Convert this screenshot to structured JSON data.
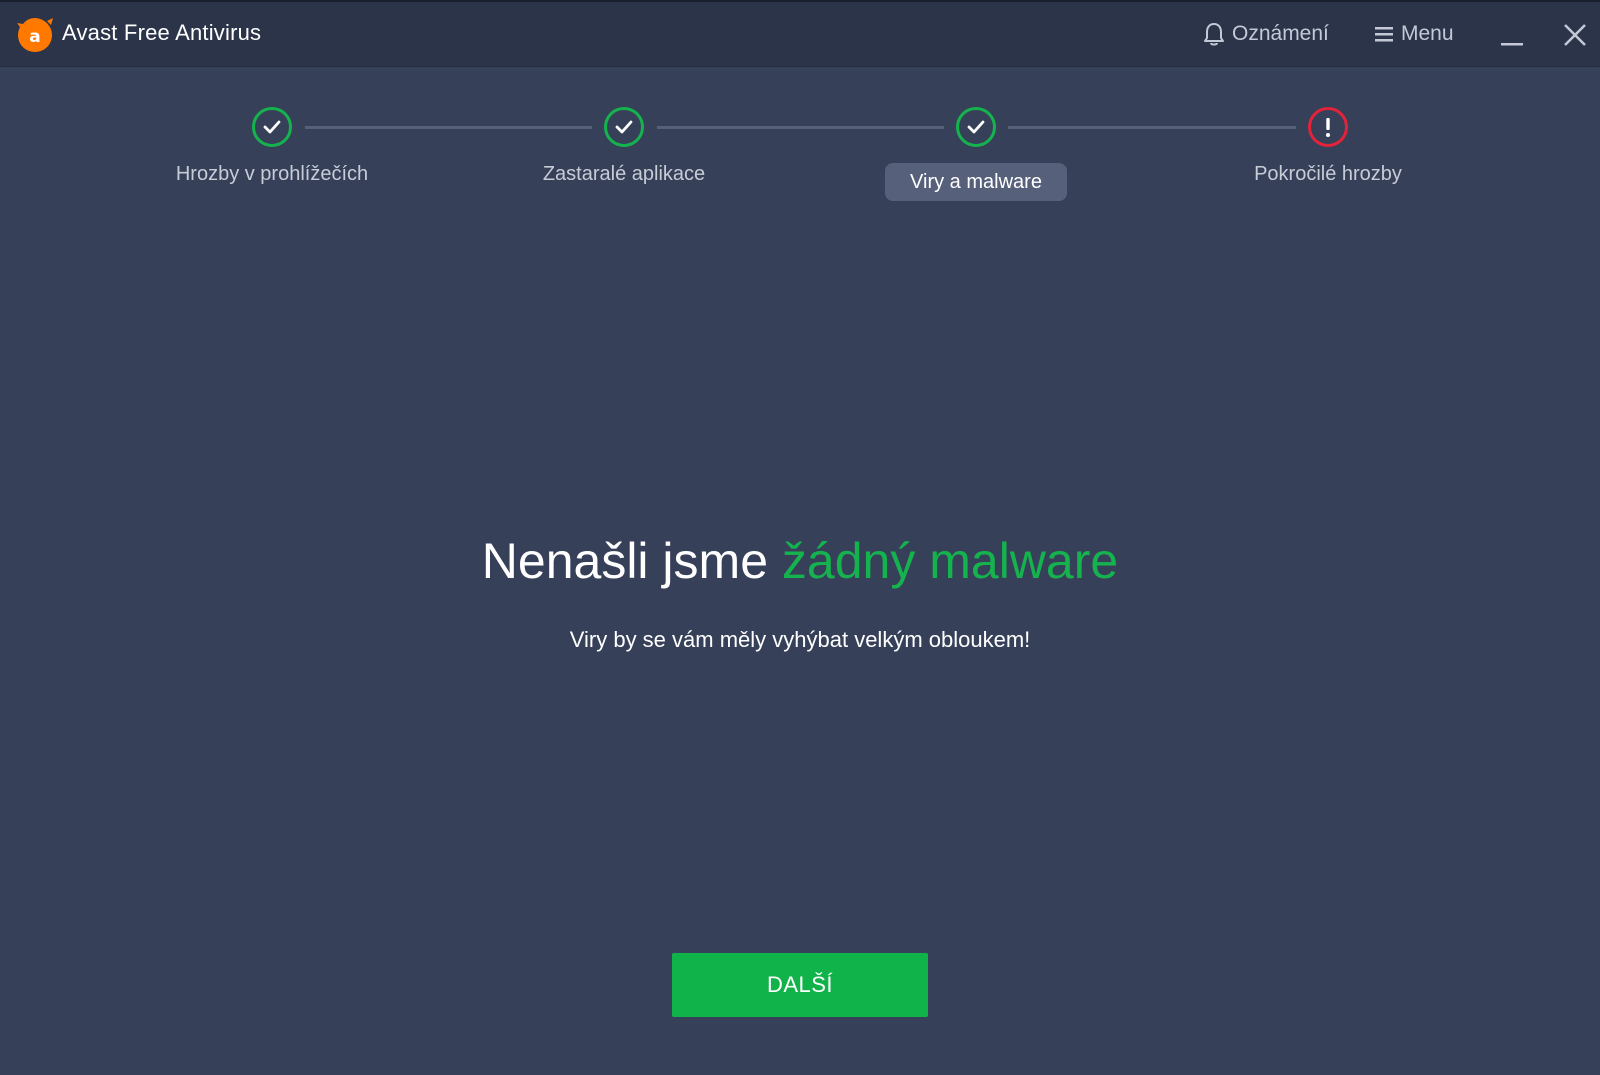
{
  "titlebar": {
    "app_title": "Avast Free Antivirus",
    "notifications_label": "Oznámení",
    "menu_label": "Menu"
  },
  "stepper": {
    "steps": [
      {
        "label": "Hrozby v prohlížečích",
        "status": "done",
        "icon": "check-icon"
      },
      {
        "label": "Zastaralé aplikace",
        "status": "done",
        "icon": "check-icon"
      },
      {
        "label": "Viry a malware",
        "status": "done",
        "icon": "check-icon",
        "active": true
      },
      {
        "label": "Pokročilé hrozby",
        "status": "warning",
        "icon": "exclamation-icon"
      }
    ]
  },
  "main": {
    "headline_prefix": "Nenašli jsme",
    "headline_accent": "žádný malware",
    "subline": "Viry by se vám měly vyhýbat velkým obloukem!",
    "next_button": "DALŠÍ"
  },
  "colors": {
    "background": "#364059",
    "titlebar": "#2c344a",
    "success_green": "#15b34e",
    "warning_red": "#e2233a",
    "brand_orange": "#ff7800"
  }
}
